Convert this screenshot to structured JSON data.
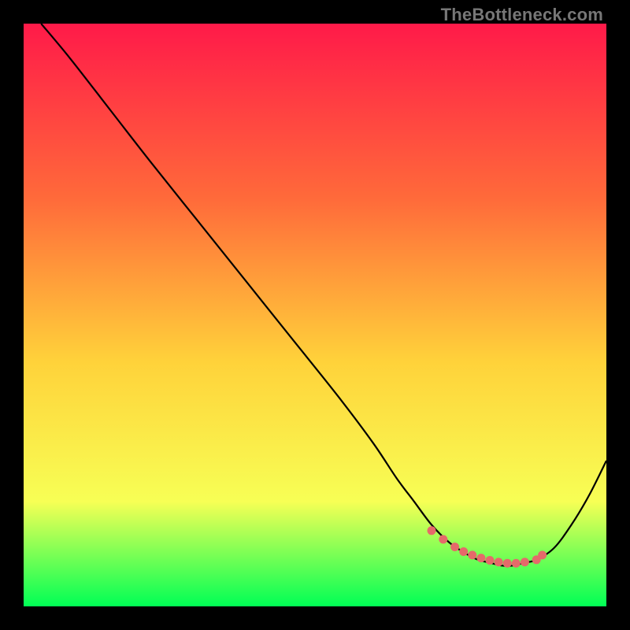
{
  "watermark": "TheBottleneck.com",
  "colors": {
    "background": "#000000",
    "gradient_top": "#ff1a49",
    "gradient_mid1": "#ff6a3a",
    "gradient_mid2": "#ffd23a",
    "gradient_mid3": "#f7ff55",
    "gradient_bottom": "#00ff55",
    "curve": "#000000",
    "marker": "#e56a6a"
  },
  "chart_data": {
    "type": "line",
    "title": "",
    "xlabel": "",
    "ylabel": "",
    "xlim": [
      0,
      100
    ],
    "ylim": [
      0,
      100
    ],
    "series": [
      {
        "name": "bottleneck-curve",
        "x": [
          3,
          8,
          15,
          22,
          30,
          38,
          46,
          54,
          60,
          64,
          67,
          70,
          73,
          76,
          78,
          80,
          82,
          84,
          86,
          88,
          91,
          94,
          97,
          100
        ],
        "y": [
          100,
          94,
          85,
          76,
          66,
          56,
          46,
          36,
          28,
          22,
          18,
          14,
          11,
          9,
          8,
          7.5,
          7,
          7,
          7.5,
          8,
          10,
          14,
          19,
          25
        ]
      }
    ],
    "markers": {
      "name": "highlighted-points",
      "x": [
        70,
        72,
        74,
        75.5,
        77,
        78.5,
        80,
        81.5,
        83,
        84.5,
        86,
        88,
        89
      ],
      "y": [
        13,
        11.5,
        10.2,
        9.4,
        8.8,
        8.3,
        7.9,
        7.6,
        7.4,
        7.4,
        7.6,
        8.0,
        8.8
      ]
    },
    "annotations": []
  }
}
